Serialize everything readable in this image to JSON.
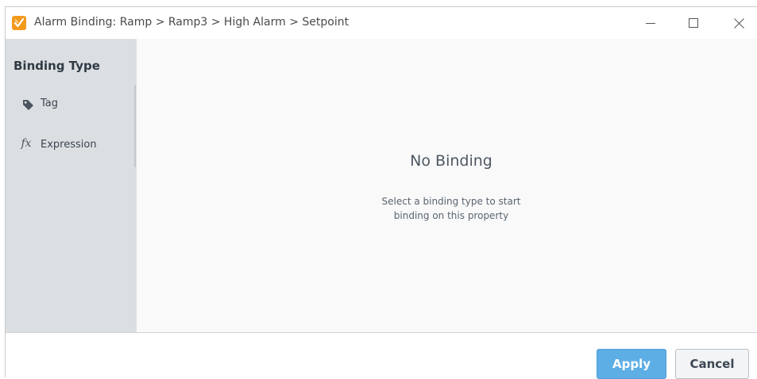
{
  "window": {
    "title": "Alarm Binding: Ramp > Ramp3 > High Alarm > Setpoint",
    "app_icon": "ignition-app-icon",
    "controls": {
      "minimize_icon": "minimize-icon",
      "maximize_icon": "maximize-icon",
      "close_icon": "close-icon"
    }
  },
  "sidebar": {
    "title": "Binding Type",
    "items": [
      {
        "label": "Tag",
        "icon": "tag-icon"
      },
      {
        "label": "Expression",
        "icon": "fx-icon",
        "glyph": "fx"
      }
    ]
  },
  "main": {
    "empty_title": "No Binding",
    "empty_description_line1": "Select a binding type to start",
    "empty_description_line2": "binding on this property"
  },
  "footer": {
    "apply_label": "Apply",
    "cancel_label": "Cancel"
  },
  "colors": {
    "accent": "#5eaee6",
    "app_icon": "#f39a1d",
    "sidebar_bg": "#dcdfe2",
    "content_bg": "#f9f9fa"
  }
}
